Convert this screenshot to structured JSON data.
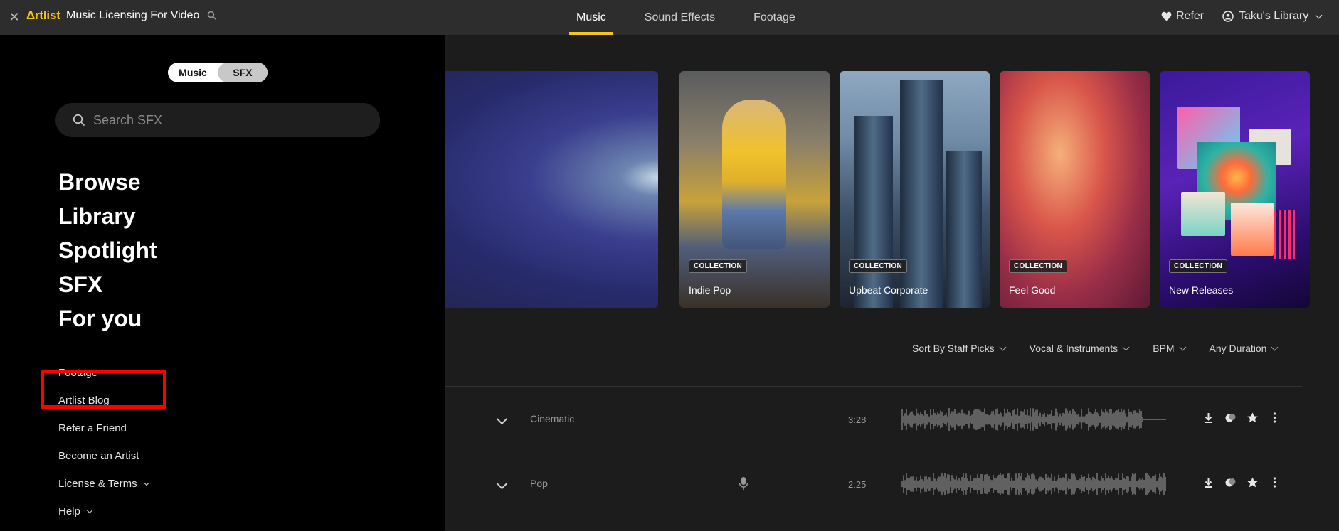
{
  "topbar": {
    "logo": "Δrtlist",
    "title": "Music Licensing For Video",
    "tabs": [
      {
        "label": "Music",
        "active": true
      },
      {
        "label": "Sound Effects",
        "active": false
      },
      {
        "label": "Footage",
        "active": false
      }
    ],
    "refer_label": "Refer",
    "account_label": "Taku's Library"
  },
  "colors": {
    "accent": "#f5c518",
    "highlight": "#ff0000"
  },
  "drawer": {
    "toggle": {
      "music": "Music",
      "sfx": "SFX",
      "active": "SFX"
    },
    "search": {
      "placeholder": "Search SFX",
      "value": ""
    },
    "main_items": [
      "Browse",
      "Library",
      "Spotlight",
      "SFX",
      "For you"
    ],
    "secondary_items": [
      {
        "label": "Footage",
        "has_dropdown": false
      },
      {
        "label": "Artlist Blog",
        "has_dropdown": false
      },
      {
        "label": "Refer a Friend",
        "has_dropdown": false,
        "highlighted": true
      },
      {
        "label": "Become an Artist",
        "has_dropdown": false
      },
      {
        "label": "License & Terms",
        "has_dropdown": true
      },
      {
        "label": "Help",
        "has_dropdown": true
      }
    ]
  },
  "collections": [
    {
      "badge": "COLLECTION",
      "label": "Indie Pop"
    },
    {
      "badge": "COLLECTION",
      "label": "Upbeat Corporate"
    },
    {
      "badge": "COLLECTION",
      "label": "Feel Good"
    },
    {
      "badge": "COLLECTION",
      "label": "New Releases"
    }
  ],
  "filters": [
    "Sort By Staff Picks",
    "Vocal & Instruments",
    "BPM",
    "Any Duration"
  ],
  "tracks": [
    {
      "genre": "Cinematic",
      "duration": "3:28",
      "vocals": false
    },
    {
      "genre": "Pop",
      "duration": "2:25",
      "vocals": true
    }
  ]
}
